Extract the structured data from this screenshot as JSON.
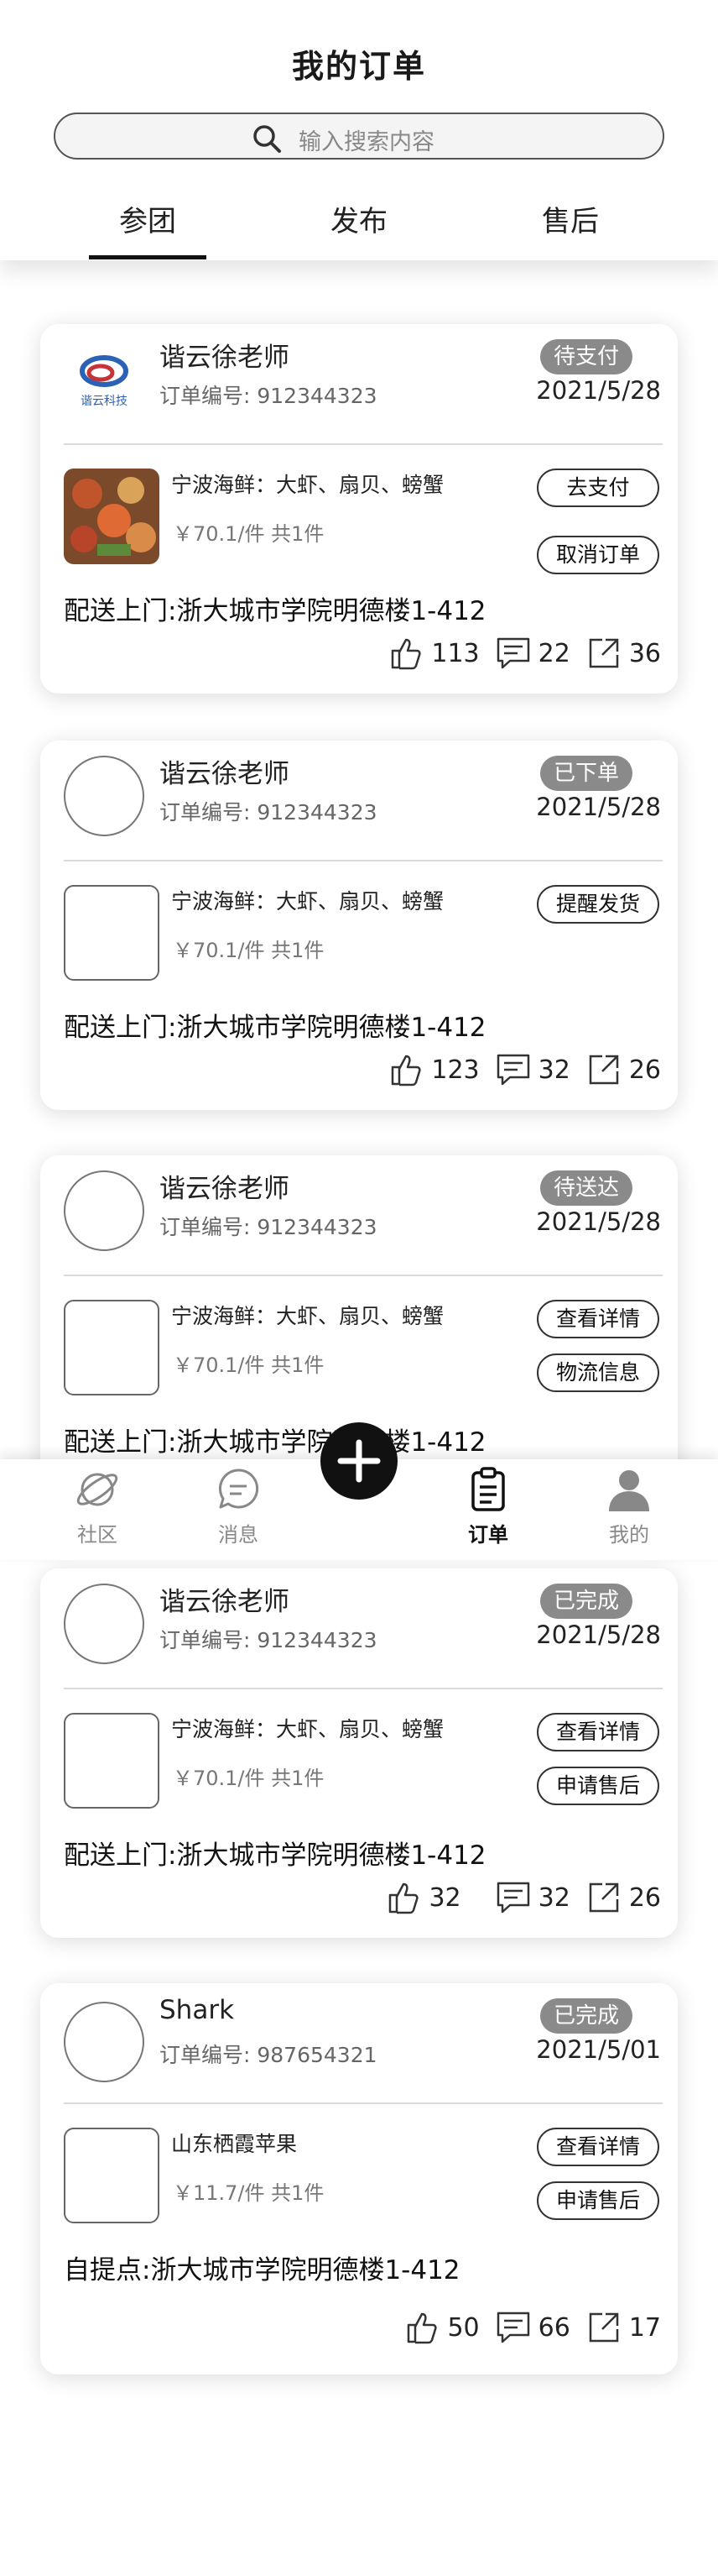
{
  "header": {
    "title": "我的订单",
    "search_placeholder": "输入搜索内容",
    "tabs": [
      {
        "label": "参团",
        "active": true
      },
      {
        "label": "发布",
        "active": false
      },
      {
        "label": "售后",
        "active": false
      }
    ]
  },
  "orders": [
    {
      "seller": "谐云徐老师",
      "order_no": "订单编号:  912344323",
      "status": "待支付",
      "date": "2021/5/28",
      "product": "宁波海鲜：大虾、扇贝、螃蟹",
      "price": "￥70.1/件 共1件",
      "actions": [
        "去支付",
        "取消订单"
      ],
      "address": "配送上门:浙大城市学院明德楼1-412",
      "likes": "113",
      "comments": "22",
      "shares": "36",
      "logo_text": "谐云科技"
    },
    {
      "seller": "谐云徐老师",
      "order_no": "订单编号:  912344323",
      "status": "已下单",
      "date": "2021/5/28",
      "product": "宁波海鲜：大虾、扇贝、螃蟹",
      "price": "￥70.1/件 共1件",
      "actions": [
        "提醒发货"
      ],
      "address": "配送上门:浙大城市学院明德楼1-412",
      "likes": "123",
      "comments": "32",
      "shares": "26"
    },
    {
      "seller": "谐云徐老师",
      "order_no": "订单编号:  912344323",
      "status": "待送达",
      "date": "2021/5/28",
      "product": "宁波海鲜：大虾、扇贝、螃蟹",
      "price": "￥70.1/件 共1件",
      "actions": [
        "查看详情",
        "物流信息"
      ],
      "address": "配送上门:浙大城市学院明德楼1-412"
    },
    {
      "seller": "谐云徐老师",
      "order_no": "订单编号:  912344323",
      "status": "已完成",
      "date": "2021/5/28",
      "product": "宁波海鲜：大虾、扇贝、螃蟹",
      "price": "￥70.1/件 共1件",
      "actions": [
        "查看详情",
        "申请售后"
      ],
      "address": "配送上门:浙大城市学院明德楼1-412",
      "likes": "32",
      "comments": "32",
      "shares": "26"
    },
    {
      "seller": "Shark",
      "order_no": "订单编号:  987654321",
      "status": "已完成",
      "date": "2021/5/01",
      "product": "山东栖霞苹果",
      "price": "￥11.7/件 共1件",
      "actions": [
        "查看详情",
        "申请售后"
      ],
      "address": "自提点:浙大城市学院明德楼1-412",
      "likes": "50",
      "comments": "66",
      "shares": "17"
    }
  ],
  "bottom_nav": {
    "items": [
      {
        "label": "社区",
        "icon": "planet-icon"
      },
      {
        "label": "消息",
        "icon": "message-icon"
      },
      {
        "label": "订单",
        "icon": "clipboard-icon",
        "active": true
      },
      {
        "label": "我的",
        "icon": "person-icon"
      }
    ],
    "fab_icon": "plus-icon"
  },
  "colors": {
    "badge": "#8a8a8a",
    "fab": "#111111",
    "accent": "#111111"
  }
}
